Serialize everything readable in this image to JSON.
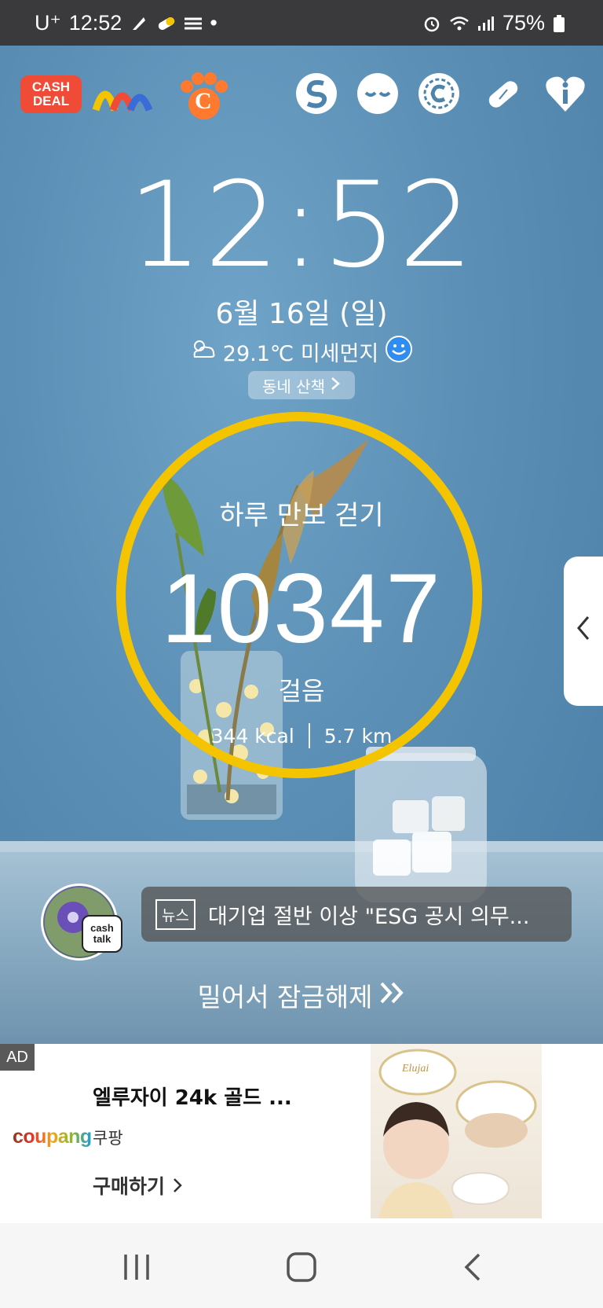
{
  "status_bar": {
    "carrier": "U⁺",
    "time": "12:52",
    "battery": "75%",
    "dot": "•"
  },
  "top_apps": {
    "cash_deal_line1": "CASH",
    "cash_deal_line2": "DEAL",
    "c_letter": "C"
  },
  "lockscreen": {
    "clock": "12:52",
    "date": "6월 16일 (일)",
    "weather": "29.1℃ 미세먼지",
    "walk_chip": "동네 산책"
  },
  "step_counter": {
    "title": "하루 만보 걷기",
    "steps": "10347",
    "unit": "걸음",
    "kcal": "344 kcal",
    "distance": "5.7 km",
    "ring_color": "#f4c400"
  },
  "news": {
    "tag": "뉴스",
    "headline": "대기업 절반 이상 \"ESG 공시 의무...",
    "badge_line1": "cash",
    "badge_line2": "talk"
  },
  "unlock": {
    "label": "밀어서 잠금해제"
  },
  "ad": {
    "tag": "AD",
    "logo": "coupang",
    "title": "엘루자이 24k 골드 ...",
    "seller": "쿠팡",
    "cta": "구매하기",
    "product_brand": "Elujai"
  },
  "colors": {
    "status_bar_bg": "#3a3a3c",
    "cash_deal_red": "#ef4b37",
    "ring_yellow": "#f4c400"
  }
}
